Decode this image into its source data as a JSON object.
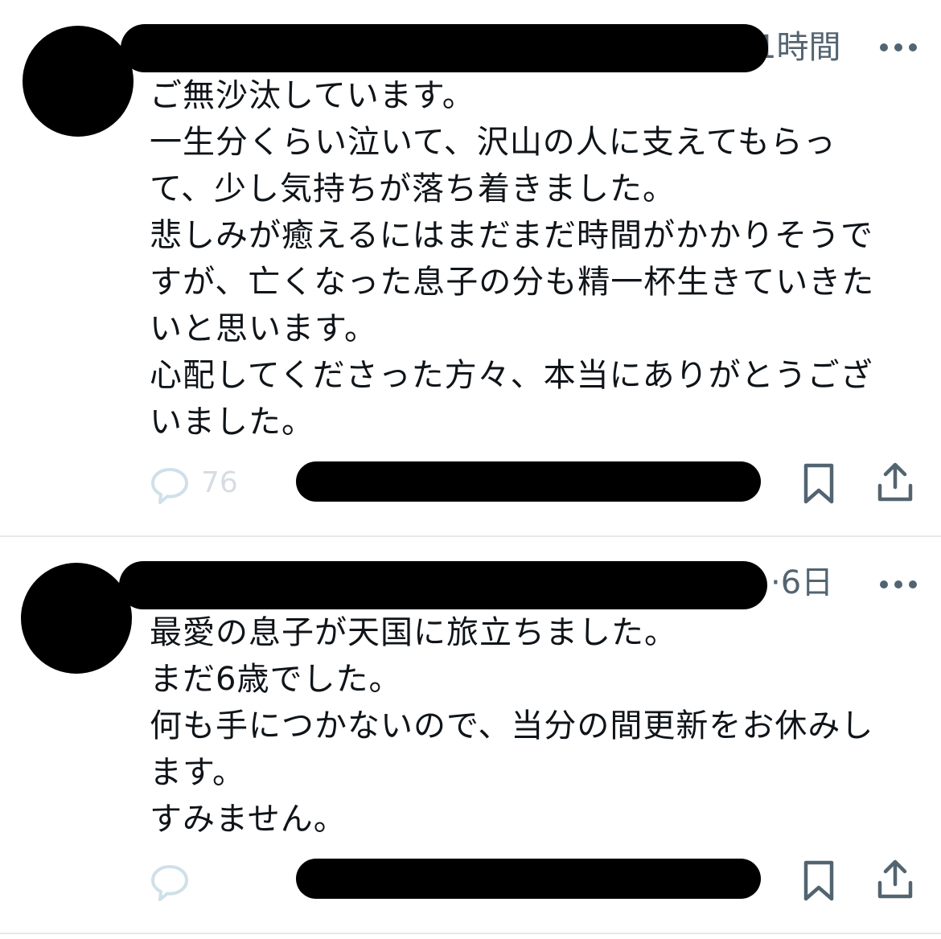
{
  "tweets": [
    {
      "timestamp": "1時間",
      "text": "ご無沙汰しています。\n一生分くらい泣いて、沢山の人に支えてもらっ\nて、少し気持ちが落ち着きました。\n悲しみが癒えるにはまだまだ時間がかかりそうで\nすが、亡くなった息子の分も精一杯生きていきた\nいと思います。\n心配してくださった方々、本当にありがとうござ\nいました。",
      "reply_count": "76"
    },
    {
      "timestamp": "·6日",
      "text": "最愛の息子が天国に旅立ちました。\nまだ6歳でした。\n何も手につかないので、当分の間更新をお休みし\nます。\nすみません。",
      "reply_count": ""
    }
  ],
  "icons": {
    "more": "more-horizontal-icon",
    "reply": "speech-bubble-icon",
    "bookmark": "bookmark-icon",
    "share": "share-upload-icon"
  },
  "colors": {
    "text": "#0f1419",
    "secondary": "#536471",
    "reply_muted": "#d6dde2",
    "divider": "#e6e9ec",
    "redaction": "#000000"
  }
}
